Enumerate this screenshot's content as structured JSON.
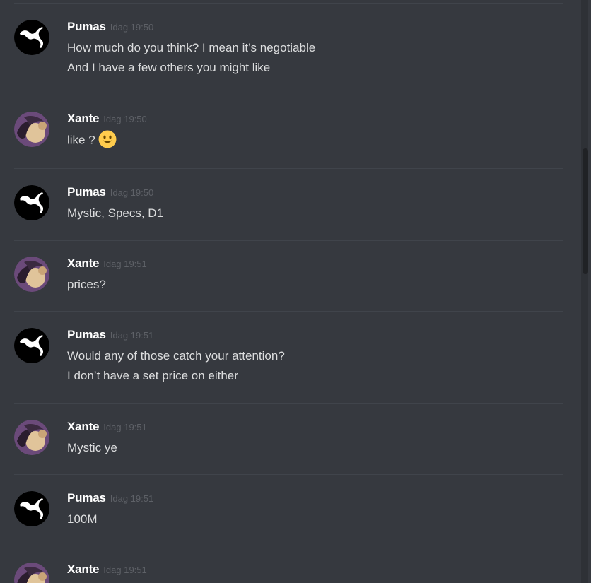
{
  "messages": [
    {
      "author": "Pumas",
      "time": "Idag 19:50",
      "lines": [
        "How much do you think? I mean it’s negotiable",
        "And I have a few others you might like"
      ]
    },
    {
      "author": "Xante",
      "time": "Idag 19:50",
      "lines": [
        "like ?"
      ],
      "emoji": "smiley-emoji"
    },
    {
      "author": "Pumas",
      "time": "Idag 19:50",
      "lines": [
        "Mystic, Specs, D1"
      ]
    },
    {
      "author": "Xante",
      "time": "Idag 19:51",
      "lines": [
        "prices?"
      ]
    },
    {
      "author": "Pumas",
      "time": "Idag 19:51",
      "lines": [
        "Would any of those catch your attention?",
        "I don’t have a set price on either"
      ]
    },
    {
      "author": "Xante",
      "time": "Idag 19:51",
      "lines": [
        "Mystic ye"
      ]
    },
    {
      "author": "Pumas",
      "time": "Idag 19:51",
      "lines": [
        "100M"
      ]
    },
    {
      "author": "Xante",
      "time": "Idag 19:51",
      "lines": []
    }
  ],
  "colors": {
    "background": "#36393f",
    "username": "#ffffff",
    "message_text": "#dcddde",
    "timestamp": "#5e6167",
    "divider": "#40444b"
  },
  "icons": {
    "pumas_avatar": "puma-logo-icon",
    "xante_avatar": "user-photo-avatar"
  }
}
